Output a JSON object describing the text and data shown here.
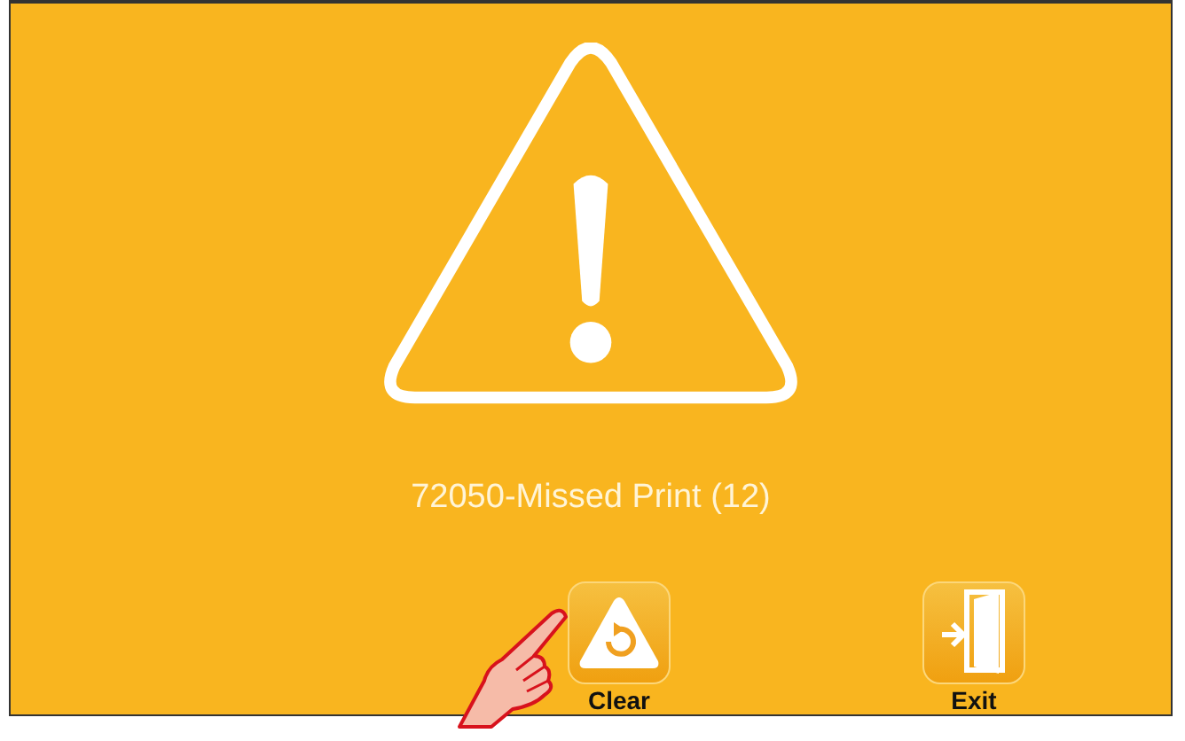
{
  "message": "72050-Missed Print (12)",
  "buttons": [
    {
      "kind": "clear",
      "label": "Clear"
    },
    {
      "kind": "exit",
      "label": "Exit"
    }
  ]
}
